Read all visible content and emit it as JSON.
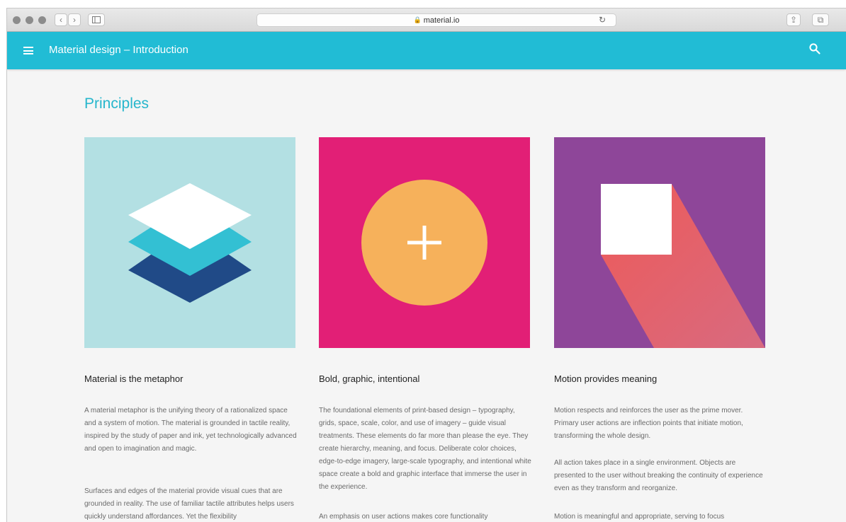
{
  "browser": {
    "url": "material.io",
    "back_glyph": "‹",
    "forward_glyph": "›",
    "reload_glyph": "↻",
    "share_glyph": "⇪",
    "tabs_glyph": "⧉"
  },
  "appbar": {
    "title": "Material design  – Introduction",
    "color": "#21bcd5"
  },
  "section": {
    "title": "Principles"
  },
  "cards": [
    {
      "heading": "Material is the metaphor",
      "image_bg": "#b3e0e3",
      "paragraphs": [
        "A material metaphor is the unifying theory of a rationalized space and a system of motion. The material is grounded in tactile reality, inspired by the study of paper and ink, yet technologically advanced and open to imagination and magic.",
        "Surfaces and edges of the material provide visual cues that are grounded in reality. The use of familiar tactile attributes helps users quickly understand affordances. Yet the flexibility"
      ]
    },
    {
      "heading": "Bold, graphic, intentional",
      "image_bg": "#e21f76",
      "paragraphs": [
        "The foundational elements of print-based design – typography, grids, space, scale, color, and use of imagery – guide visual treatments. These elements do far more than please the eye. They create hierarchy, meaning, and focus. Deliberate color choices, edge-to-edge imagery, large-scale typography, and intentional white space create a bold and graphic interface that immerse the user in the experience.",
        "An emphasis on user actions makes core functionality"
      ]
    },
    {
      "heading": "Motion provides meaning",
      "image_bg": "#8e4699",
      "paragraphs": [
        "Motion respects and reinforces the user as the prime mover. Primary user actions are inflection points that initiate motion, transforming the whole design.",
        "All action takes place in a single environment. Objects are presented to the user without breaking the continuity of experience even as they transform and reorganize.",
        "Motion is meaningful and appropriate, serving to focus"
      ]
    }
  ]
}
